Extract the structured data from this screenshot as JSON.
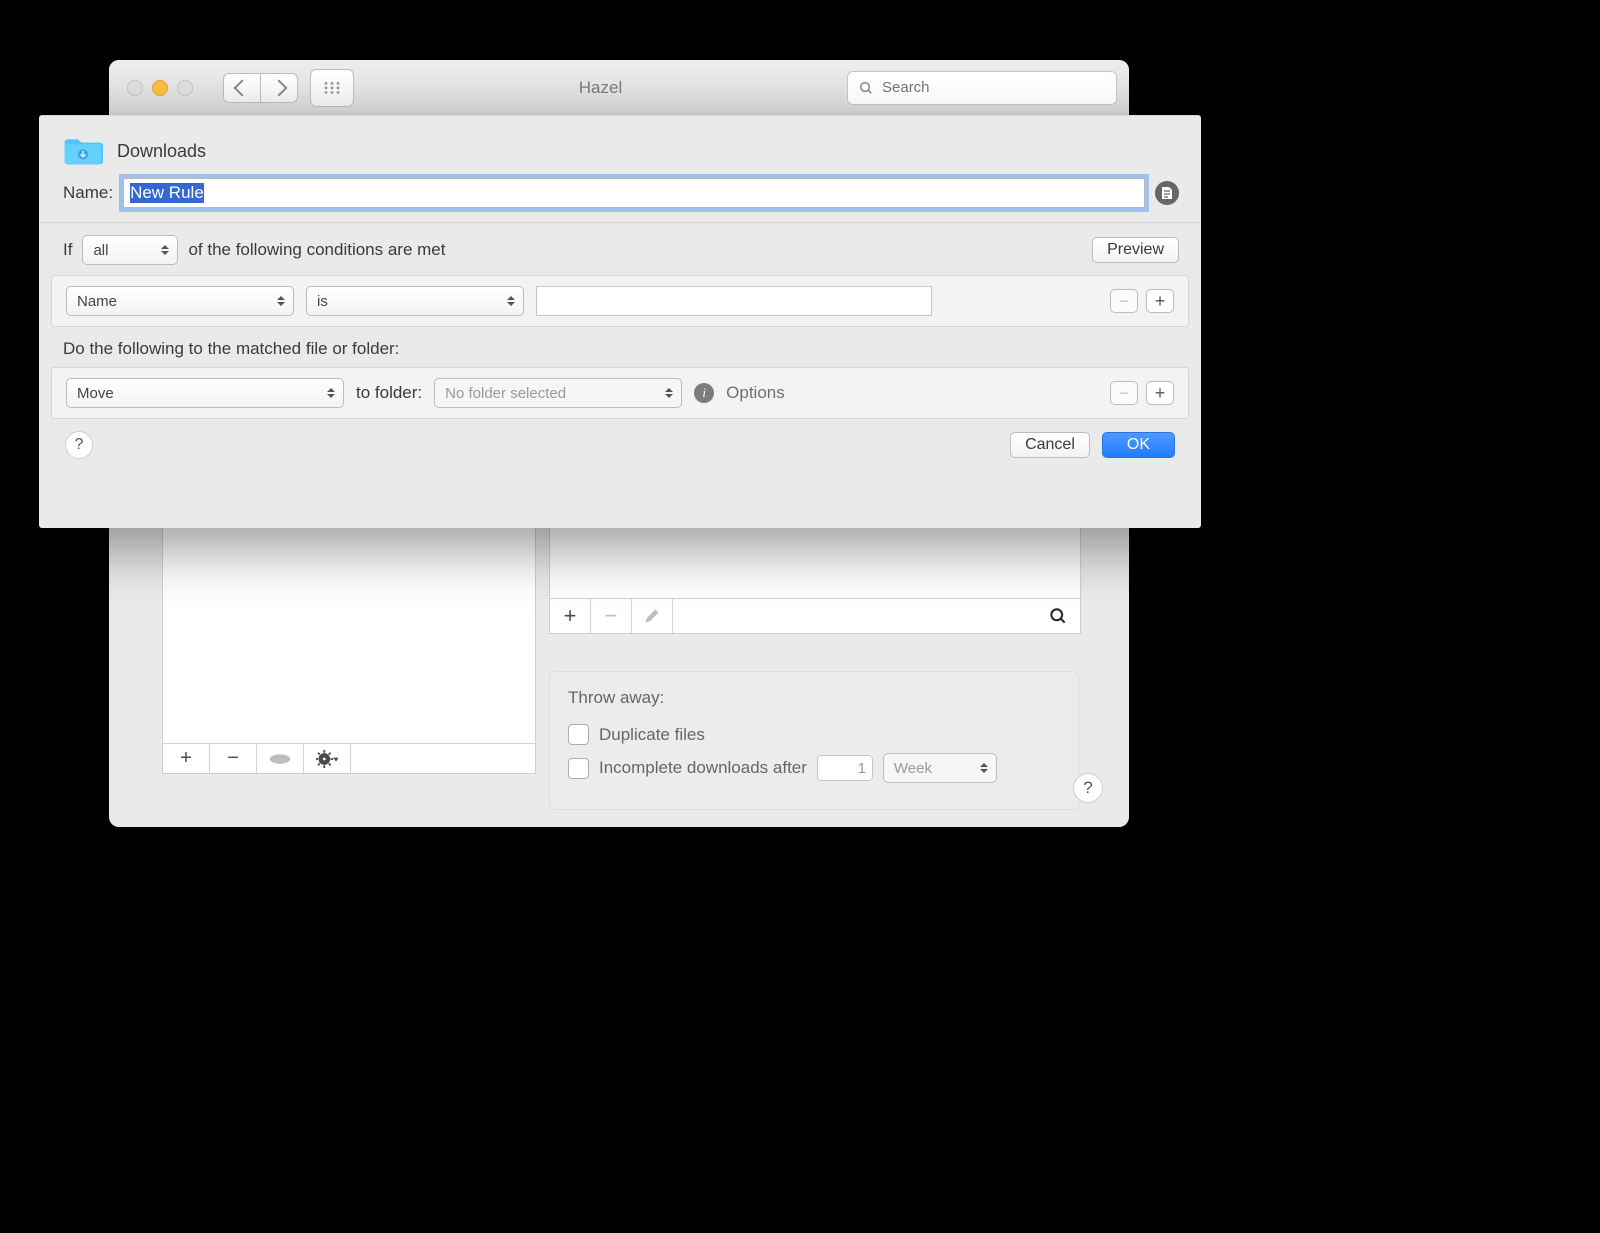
{
  "window": {
    "title": "Hazel",
    "search_placeholder": "Search"
  },
  "sheet": {
    "folder_name": "Downloads",
    "name_label": "Name:",
    "name_value": "New Rule",
    "if_prefix": "If",
    "if_scope": "all",
    "if_suffix": "of the following conditions are met",
    "preview_label": "Preview",
    "condition": {
      "attribute": "Name",
      "operator": "is",
      "value": ""
    },
    "actions_label": "Do the following to the matched file or folder:",
    "action": {
      "verb": "Move",
      "to_label": "to folder:",
      "folder": "No folder selected",
      "options_label": "Options"
    },
    "cancel_label": "Cancel",
    "ok_label": "OK"
  },
  "throw_away": {
    "heading": "Throw away:",
    "dup_label": "Duplicate files",
    "incomplete_label": "Incomplete downloads after",
    "incomplete_value": "1",
    "incomplete_unit": "Week"
  }
}
